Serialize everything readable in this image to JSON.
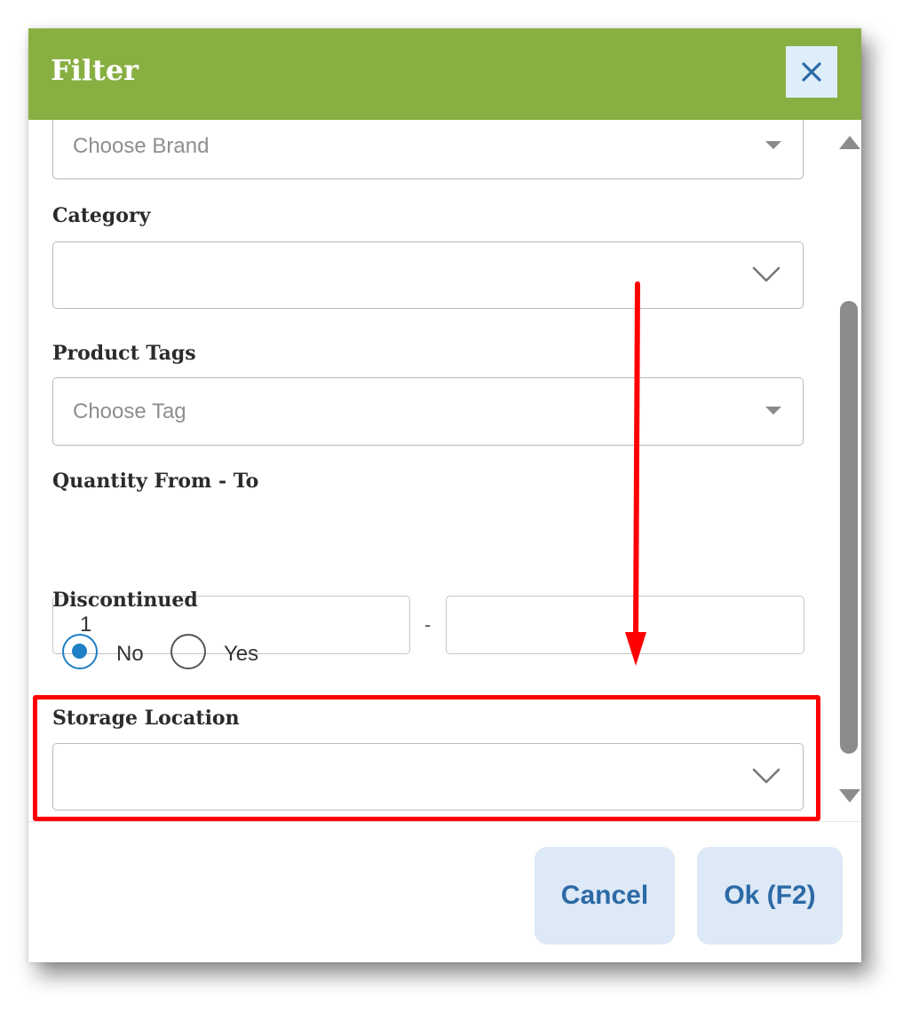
{
  "dialog": {
    "title": "Filter",
    "close_icon": "close-icon"
  },
  "brand": {
    "placeholder": "Choose Brand"
  },
  "category": {
    "label": "Category",
    "value": ""
  },
  "product_tags": {
    "label": "Product Tags",
    "placeholder": "Choose Tag"
  },
  "quantity": {
    "label": "Quantity From - To",
    "from_value": "1",
    "separator": "-",
    "to_value": ""
  },
  "discontinued": {
    "label": "Discontinued",
    "options": [
      {
        "label": "No",
        "selected": true
      },
      {
        "label": "Yes",
        "selected": false
      }
    ]
  },
  "storage_location": {
    "label": "Storage Location",
    "value": ""
  },
  "footer": {
    "cancel_label": "Cancel",
    "ok_label": "Ok (F2)"
  },
  "colors": {
    "header": "#88af42",
    "accent": "#1f7fc4",
    "button_bg": "#dde9f6",
    "button_text": "#2c6aa6",
    "annotation": "#ff0000"
  }
}
